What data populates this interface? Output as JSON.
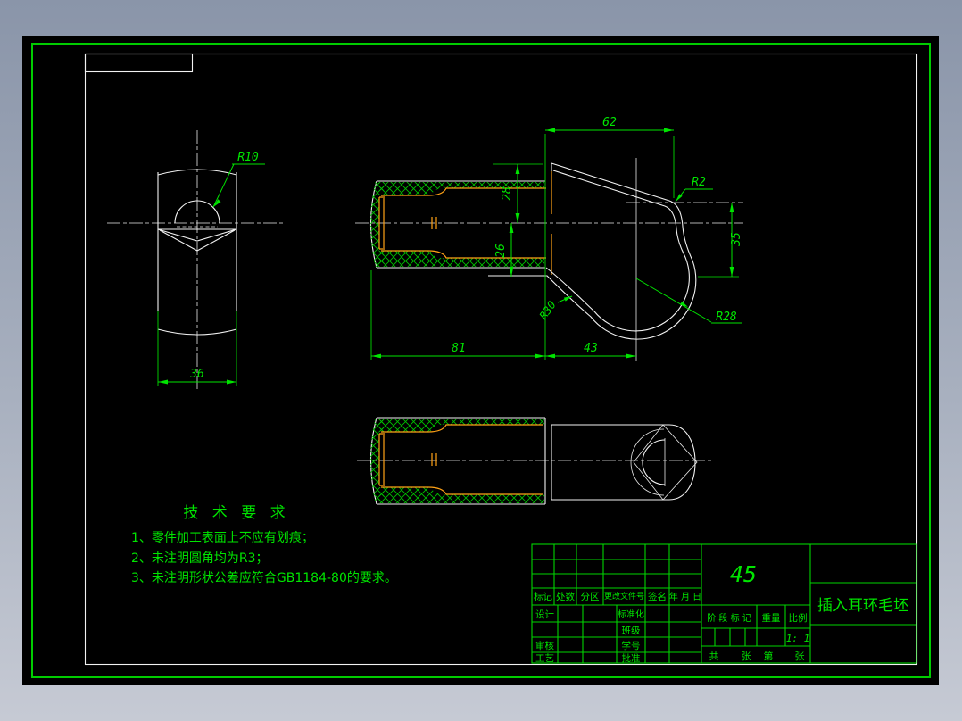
{
  "colors": {
    "background_top": "#8a95a9",
    "background_bottom": "#c6cad4",
    "paper": "#000000",
    "line_green": "#00e400",
    "line_white": "#f2f2f2",
    "line_orange": "#ffa216"
  },
  "views": {
    "front_view": {
      "radius_label": "R10",
      "width_dim": "36"
    },
    "section_view": {
      "top_dim": "62",
      "upper_dim": "28",
      "lower_dim": "26",
      "height_dim": "35",
      "length_dim": "81",
      "eye_length_dim": "43",
      "fillet_label": "R2",
      "neck_radius_label": "R30",
      "eye_radius_label": "R28"
    }
  },
  "tech_requirements": {
    "title": "技 术 要 求",
    "items": [
      "1、零件加工表面上不应有划痕；",
      "2、未注明圆角均为R3；",
      "3、未注明形状公差应符合GB1184-80的要求。"
    ]
  },
  "title_block": {
    "material": "45",
    "part_name": "插入耳环毛坯",
    "revision_headers": [
      "标记",
      "处数",
      "分区",
      "更改文件号",
      "签名",
      "年 月 日"
    ],
    "labels": {
      "design": "设计",
      "standardization": "标准化",
      "grade": "班级",
      "audit": "审核",
      "serial": "学号",
      "process": "工艺",
      "approve": "批准",
      "stage_mark": "阶 段 标 记",
      "weight": "重量",
      "scale": "比例",
      "scale_value": "1: 1",
      "sheet_total": "共",
      "sheet_unit1": "张",
      "sheet_no": "第",
      "sheet_unit2": "张"
    }
  }
}
